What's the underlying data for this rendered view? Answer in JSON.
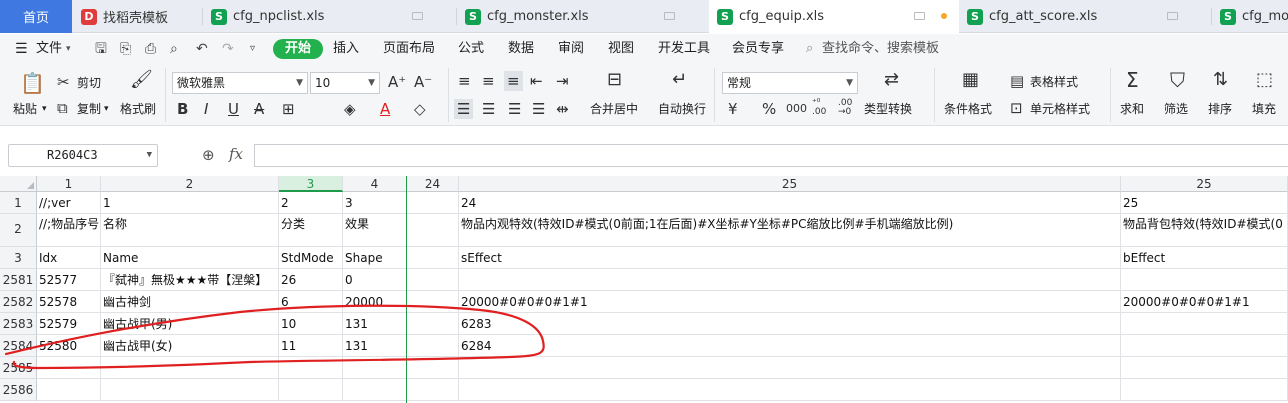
{
  "tabs": [
    {
      "label": "首页"
    },
    {
      "label": "找稻壳模板",
      "icon": "docer-icon"
    },
    {
      "label": "cfg_npclist.xls",
      "icon": "spreadsheet-icon"
    },
    {
      "label": "cfg_monster.xls",
      "icon": "spreadsheet-icon"
    },
    {
      "label": "cfg_equip.xls",
      "icon": "spreadsheet-icon"
    },
    {
      "label": "cfg_att_score.xls",
      "icon": "spreadsheet-icon"
    },
    {
      "label": "cfg_mo",
      "icon": "spreadsheet-icon"
    }
  ],
  "menu": {
    "file": "文件",
    "items": [
      "开始",
      "插入",
      "页面布局",
      "公式",
      "数据",
      "审阅",
      "视图",
      "开发工具",
      "会员专享"
    ],
    "search": "查找命令、搜索模板"
  },
  "ribbon": {
    "paste": "粘贴",
    "cut": "剪切",
    "copy": "复制",
    "format_painter": "格式刷",
    "font_name": "微软雅黑",
    "font_size": "10",
    "merge_center": "合并居中",
    "wrap_text": "自动换行",
    "number_format": "常规",
    "type_convert": "类型转换",
    "table_style": "表格样式",
    "conditional_format": "条件格式",
    "cell_style": "单元格样式",
    "sum": "求和",
    "filter": "筛选",
    "sort": "排序",
    "fill": "填充"
  },
  "formula_bar": {
    "name_box": "R2604C3",
    "fx": "fx"
  },
  "grid": {
    "columns": [
      "1",
      "2",
      "3",
      "4",
      "24",
      "25",
      "25"
    ],
    "selected_column": "3",
    "rows": [
      {
        "num": "1",
        "cells": [
          "//;ver",
          "1",
          "2",
          "3",
          "",
          "24",
          "25"
        ]
      },
      {
        "num": "2",
        "cells": [
          "//;物品序号",
          "名称",
          "分类",
          "效果",
          "",
          "物品内观特效(特效ID#模式(0前面;1在后面)#X坐标#Y坐标#PC缩放比例#手机端缩放比例)",
          "物品背包特效(特效ID#模式(0"
        ]
      },
      {
        "num": "3",
        "cells": [
          "Idx",
          "Name",
          "StdMode",
          "Shape",
          "",
          "sEffect",
          "bEffect"
        ]
      },
      {
        "num": "2581",
        "cells": [
          "52577",
          "『弑神』無极★★★带【涅槃】",
          "26",
          "0",
          "",
          "",
          ""
        ]
      },
      {
        "num": "2582",
        "cells": [
          "52578",
          "幽古神剑",
          "6",
          "20000",
          "",
          "20000#0#0#0#1#1",
          "20000#0#0#0#1#1"
        ]
      },
      {
        "num": "2583",
        "cells": [
          "52579",
          "幽古战甲(男)",
          "10",
          "131",
          "",
          "6283",
          ""
        ]
      },
      {
        "num": "2584",
        "cells": [
          "52580",
          "幽古战甲(女)",
          "11",
          "131",
          "",
          "6284",
          ""
        ]
      },
      {
        "num": "2585",
        "cells": [
          "",
          "",
          "",
          "",
          "",
          "",
          ""
        ]
      },
      {
        "num": "2586",
        "cells": [
          "",
          "",
          "",
          "",
          "",
          "",
          ""
        ]
      }
    ]
  },
  "colors": {
    "accent_green": "#22b14c",
    "home_tab": "#3f78e0",
    "annotation_red": "#e02020"
  }
}
